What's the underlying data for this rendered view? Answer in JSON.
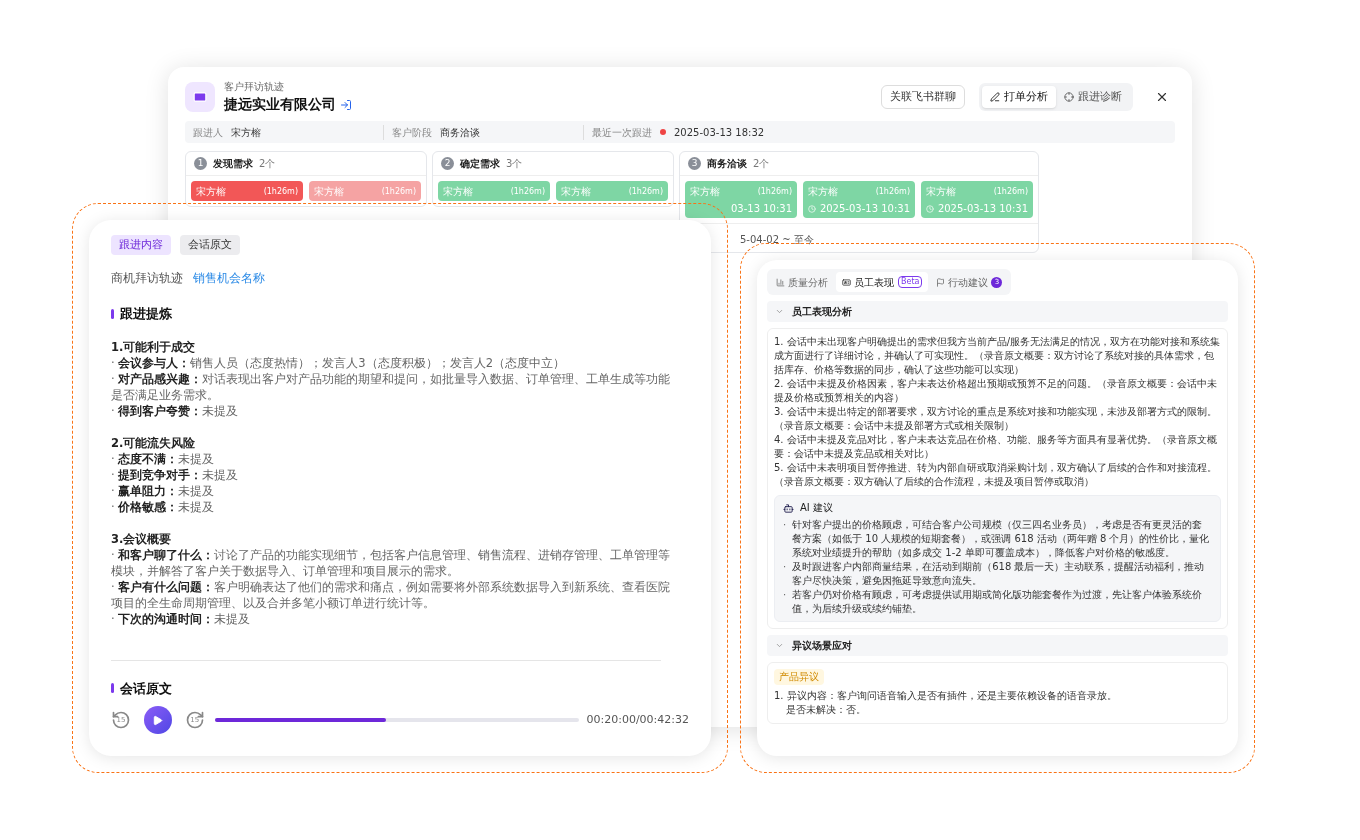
{
  "back_window": {
    "subtitle": "客户拜访轨迹",
    "title": "捷远实业有限公司",
    "link_button": "关联飞书群聊",
    "segments": [
      {
        "label": "打单分析",
        "selected": true,
        "kind": "pen"
      },
      {
        "label": "跟进诊断",
        "selected": false,
        "kind": "target"
      }
    ],
    "info": [
      {
        "label": "跟进人",
        "value": "宋方榕",
        "kind": "plain"
      },
      {
        "label": "客户阶段",
        "value": "商务洽谈",
        "kind": "plain"
      },
      {
        "label": "最近一次跟进",
        "value": "2025-03-13 18:32",
        "kind": "dot"
      }
    ],
    "stages": [
      {
        "number": "1",
        "name": "发现需求",
        "count": "2个",
        "cards": [
          {
            "name": "宋方榕",
            "duration": "(1h26m)",
            "color": "#f25757"
          },
          {
            "name": "宋方榕",
            "duration": "(1h26m)",
            "color": "#f5a3a3"
          }
        ]
      },
      {
        "number": "2",
        "name": "确定需求",
        "count": "3个",
        "cards": [
          {
            "name": "宋方榕",
            "duration": "(1h26m)",
            "color": "#7ed6a4"
          },
          {
            "name": "宋方榕",
            "duration": "(1h26m)",
            "color": "#7ed6a4"
          }
        ]
      },
      {
        "number": "3",
        "name": "商务洽谈",
        "count": "2个",
        "footer": "5-04-02 ~ 至今",
        "cards": [
          {
            "name": "宋方榕",
            "duration": "(1h26m)",
            "date": "03-13 10:31",
            "icon": false,
            "color": "#7ed6a4"
          },
          {
            "name": "宋方榕",
            "duration": "(1h26m)",
            "date": "2025-03-13 10:31",
            "icon": true,
            "color": "#7ed6a4"
          },
          {
            "name": "宋方榕",
            "duration": "(1h26m)",
            "date": "2025-03-13 10:31",
            "icon": true,
            "color": "#7ed6a4"
          }
        ]
      }
    ]
  },
  "left_card": {
    "tabs": [
      {
        "label": "跟进内容",
        "selected": true
      },
      {
        "label": "会话原文",
        "selected": false
      }
    ],
    "breadcrumb": "商机拜访轨迹",
    "link": "销售机会名称",
    "heading": "跟进提炼",
    "sections": [
      {
        "title": "1.可能利于成交",
        "lines": [
          "· **会议参与人：**销售人员（态度热情）；发言人3（态度积极）；发言人2（态度中立）",
          "· **对产品感兴趣：**对话表现出客户对产品功能的期望和提问，如批量导入数据、订单管理、工单生成等功能是否满足业务需求。",
          "· **得到客户夸赞：**未提及"
        ]
      },
      {
        "title": "2.可能流失风险",
        "lines": [
          "· **态度不满：**未提及",
          "· **提到竞争对手：**未提及",
          "· **赢单阻力：**未提及",
          "· **价格敏感：**未提及"
        ]
      },
      {
        "title": "3.会议概要",
        "lines": [
          "· **和客户聊了什么：**讨论了产品的功能实现细节，包括客户信息管理、销售流程、进销存管理、工单管理等模块，并解答了客户关于数据导入、订单管理和项目展示的需求。",
          "· **客户有什么问题：**客户明确表达了他们的需求和痛点，例如需要将外部系统数据导入到新系统、查看医院项目的全生命周期管理、以及合并多笔小额订单进行统计等。",
          "· **下次的沟通时间：**未提及"
        ]
      }
    ],
    "next_heading": "会话原文",
    "player": {
      "skip_back": "15",
      "skip_forward": "15",
      "level": 0.47,
      "time": "00:20:00/00:42:32"
    }
  },
  "right_card": {
    "tabs": [
      {
        "label": "质量分析",
        "selected": false,
        "kind": "chart"
      },
      {
        "label": "员工表现",
        "selected": true,
        "kind": "card",
        "badge": "Beta"
      },
      {
        "label": "行动建议",
        "selected": false,
        "kind": "flag",
        "count": "3"
      }
    ],
    "sections": [
      {
        "title": "员工表现分析",
        "expanded": true,
        "kind": "analysis",
        "items": [
          "1. 会话中未出现客户明确提出的需求但我方当前产品/服务无法满足的情况，双方在功能对接和系统集成方面进行了详细讨论，并确认了可实现性。（录音原文概要：双方讨论了系统对接的具体需求，包括库存、价格等数据的同步，确认了这些功能可以实现）",
          "2. 会话中未提及价格因素，客户未表达价格超出预期或预算不足的问题。（录音原文概要：会话中未提及价格或预算相关的内容）",
          "3. 会话中未提出特定的部署要求，双方讨论的重点是系统对接和功能实现，未涉及部署方式的限制。（录音原文概要：会话中未提及部署方式或相关限制）",
          "4. 会话中未提及竞品对比，客户未表达竞品在价格、功能、服务等方面具有显著优势。（录音原文概要：会话中未提及竞品或相关对比）",
          "5. 会话中未表明项目暂停推进、转为内部自研或取消采购计划，双方确认了后续的合作和对接流程。（录音原文概要：双方确认了后续的合作流程，未提及项目暂停或取消）"
        ],
        "ai": {
          "title": "AI 建议",
          "bullet": "·",
          "items": [
            "针对客户提出的价格顾虑，可结合客户公司规模（仅三四名业务员），考虑是否有更灵活的套餐方案（如低于 10 人规模的短期套餐），或强调 618 活动（两年赠 8 个月）的性价比，量化系统对业绩提升的帮助（如多成交 1-2 单即可覆盖成本），降低客户对价格的敏感度。",
            "及时跟进客户内部商量结果，在活动到期前（618 最后一天）主动联系，提醒活动福利，推动客户尽快决策，避免因拖延导致意向流失。",
            "若客户仍对价格有顾虑，可考虑提供试用期或简化版功能套餐作为过渡，先让客户体验系统价值，为后续升级或续约铺垫。"
          ]
        }
      },
      {
        "title": "异议场景应对",
        "expanded": true,
        "kind": "objection",
        "tag": "产品异议",
        "items": [
          "1. 异议内容：客户询问语音输入是否有插件，还是主要依赖设备的语音录放。",
          "是否未解决：否。"
        ]
      }
    ]
  }
}
